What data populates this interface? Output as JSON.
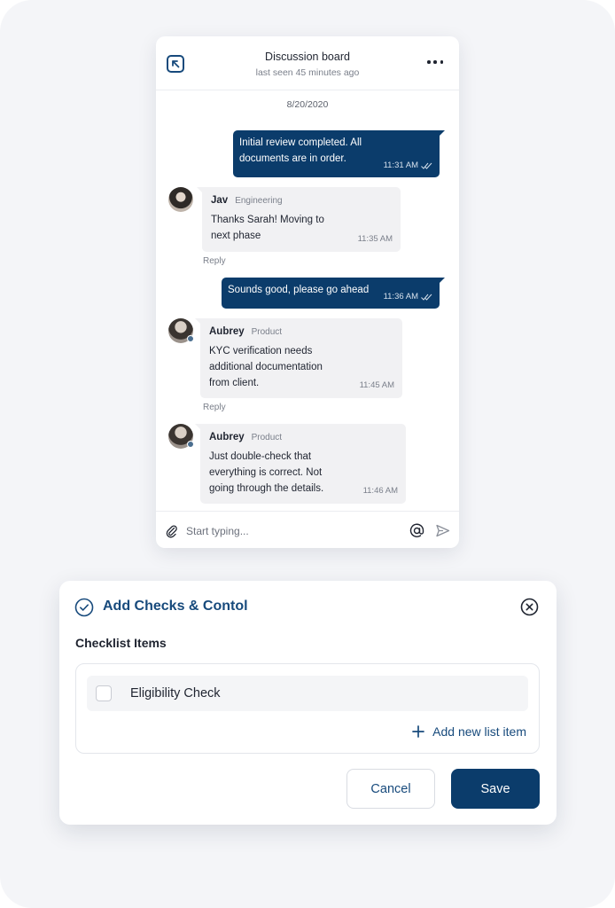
{
  "colors": {
    "primary": "#0b3c6b",
    "accent_text": "#174a7c",
    "incoming_bubble": "#f1f1f3",
    "background": "#f4f5f8"
  },
  "chat": {
    "title": "Discussion board",
    "subtitle": "last seen 45 minutes ago",
    "date": "8/20/2020",
    "messages": [
      {
        "direction": "out",
        "lines": [
          "Initial review completed. All",
          "documents are in order."
        ],
        "time": "11:31 AM"
      },
      {
        "direction": "in",
        "sender": "Jav",
        "dept": "Engineering",
        "lines": [
          "Thanks Sarah! Moving to",
          "next phase"
        ],
        "time": "11:35 AM",
        "reply": "Reply"
      },
      {
        "direction": "out",
        "lines": [
          "Sounds good, please go ahead"
        ],
        "time": "11:36 AM"
      },
      {
        "direction": "in",
        "sender": "Aubrey",
        "dept": "Product",
        "lines": [
          "KYC verification needs",
          "additional documentation",
          "from client."
        ],
        "time": "11:45 AM",
        "reply": "Reply"
      },
      {
        "direction": "in",
        "sender": "Aubrey",
        "dept": "Product",
        "lines": [
          "Just double-check that",
          "everything is correct. Not",
          "going through the details."
        ],
        "time": "11:46 AM"
      }
    ],
    "composer": {
      "placeholder": "Start typing..."
    },
    "icons": {
      "back": "arrow-up-left-icon",
      "more": "more-horizontal-icon",
      "attach": "paperclip-icon",
      "mention": "at-sign-icon",
      "send": "send-icon",
      "read_receipt": "double-check-icon"
    }
  },
  "checks_modal": {
    "title": "Add Checks & Contol",
    "section_label": "Checklist Items",
    "items": [
      {
        "label": "Eligibility Check",
        "checked": false
      }
    ],
    "add_item_label": "Add new list item",
    "cancel_label": "Cancel",
    "save_label": "Save",
    "icons": {
      "title": "check-circle-icon",
      "close": "close-circle-icon",
      "add": "plus-icon"
    }
  }
}
